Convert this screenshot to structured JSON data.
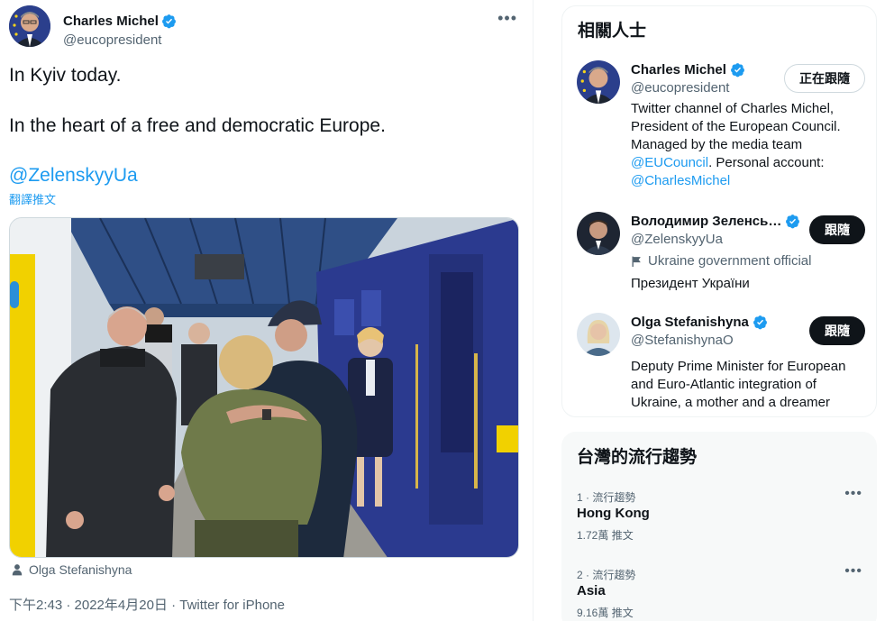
{
  "tweet": {
    "author": {
      "name": "Charles Michel",
      "handle": "@eucopresident",
      "verified": true
    },
    "more_icon": "more-horizontal-icon",
    "text_line1": "In Kyiv today.",
    "text_line2": "In the heart of a free and democratic Europe.",
    "mention": "@ZelenskyyUa",
    "translate_label": "翻譯推文",
    "tagged_person": "Olga Stefanishyna",
    "meta": "下午2:43 · 2022年4月20日 · Twitter for iPhone"
  },
  "relevant_people": {
    "title": "相關人士",
    "people": [
      {
        "name": "Charles Michel",
        "handle": "@eucopresident",
        "button": "正在跟隨",
        "bio_parts": [
          "Twitter channel of Charles Michel, President of the European Council. Managed by the media team ",
          "@EUCouncil",
          ". Personal account: ",
          "@CharlesMichel"
        ]
      },
      {
        "name": "Володимир Зеленсь…",
        "handle": "@ZelenskyyUa",
        "button": "跟隨",
        "gov_label": "Ukraine government official",
        "bio": "Президент України"
      },
      {
        "name": "Olga Stefanishyna",
        "handle": "@StefanishynaO",
        "button": "跟隨",
        "bio": "Deputy Prime Minister for European and Euro-Atlantic integration of Ukraine, a mother and a dreamer"
      }
    ]
  },
  "trends": {
    "title": "台灣的流行趨勢",
    "items": [
      {
        "meta": "1 · 流行趨勢",
        "name": "Hong Kong",
        "count": "1.72萬 推文"
      },
      {
        "meta": "2 · 流行趨勢",
        "name": "Asia",
        "count": "9.16萬 推文"
      }
    ]
  },
  "colors": {
    "accent": "#1d9bf0",
    "text": "#0f1419",
    "muted": "#536471"
  }
}
